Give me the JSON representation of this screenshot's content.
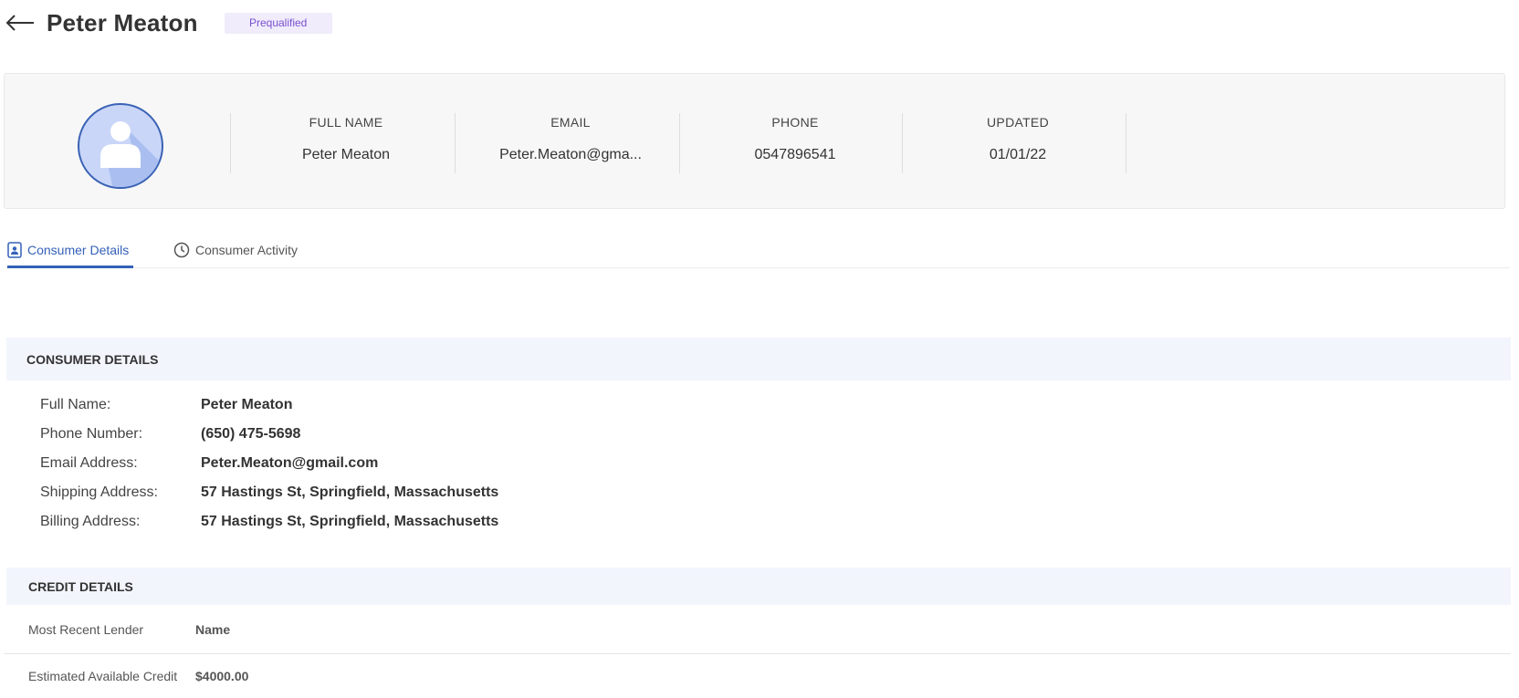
{
  "header": {
    "back_icon": "arrow-left-icon",
    "title": "Peter Meaton",
    "status_badge": "Prequalified",
    "badge_color": "#7a4fd1"
  },
  "summary": {
    "avatar_icon": "person-avatar-icon",
    "fields": [
      {
        "label": "FULL NAME",
        "value": "Peter Meaton"
      },
      {
        "label": "EMAIL",
        "value": "Peter.Meaton@gma..."
      },
      {
        "label": "PHONE",
        "value": "0547896541"
      },
      {
        "label": "UPDATED",
        "value": "01/01/22"
      }
    ]
  },
  "tabs": [
    {
      "label": "Consumer Details",
      "icon": "contact-card-icon",
      "active": true
    },
    {
      "label": "Consumer Activity",
      "icon": "clock-icon",
      "active": false
    }
  ],
  "consumer_details": {
    "heading": "CONSUMER DETAILS",
    "rows": [
      {
        "label": "Full Name:",
        "value": "Peter Meaton"
      },
      {
        "label": "Phone Number:",
        "value": "(650) 475-5698"
      },
      {
        "label": "Email Address:",
        "value": "Peter.Meaton@gmail.com"
      },
      {
        "label": "Shipping Address:",
        "value": "57 Hastings St, Springfield, Massachusetts"
      },
      {
        "label": "Billing Address:",
        "value": "57 Hastings St, Springfield, Massachusetts"
      }
    ]
  },
  "credit_details": {
    "heading": "CREDIT DETAILS",
    "rows": [
      {
        "label": "Most Recent Lender",
        "value": "Name"
      },
      {
        "label": "Estimated Available Credit",
        "value": "$4000.00"
      }
    ]
  },
  "colors": {
    "accent": "#3461b8",
    "section_bg": "#f2f5fc",
    "summary_bg": "#f7f7f7"
  }
}
